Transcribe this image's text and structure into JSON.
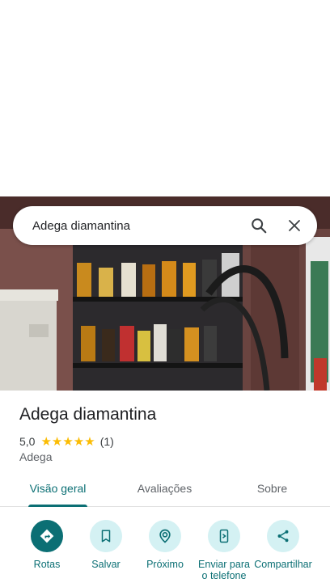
{
  "search": {
    "query": "Adega diamantina"
  },
  "place": {
    "title": "Adega diamantina",
    "rating": "5,0",
    "stars": "★★★★★",
    "review_count": "(1)",
    "category": "Adega"
  },
  "tabs": [
    {
      "label": "Visão geral",
      "active": true
    },
    {
      "label": "Avaliações",
      "active": false
    },
    {
      "label": "Sobre",
      "active": false
    }
  ],
  "actions": [
    {
      "label": "Rotas",
      "icon": "directions-icon"
    },
    {
      "label": "Salvar",
      "icon": "bookmark-icon"
    },
    {
      "label": "Próximo",
      "icon": "nearby-icon"
    },
    {
      "label": "Enviar para o telefone",
      "icon": "send-to-phone-icon"
    },
    {
      "label": "Compartilhar",
      "icon": "share-icon"
    }
  ],
  "colors": {
    "accent": "#0b6f74",
    "action_bg": "#d4f1f3",
    "star": "#fbbc04"
  }
}
